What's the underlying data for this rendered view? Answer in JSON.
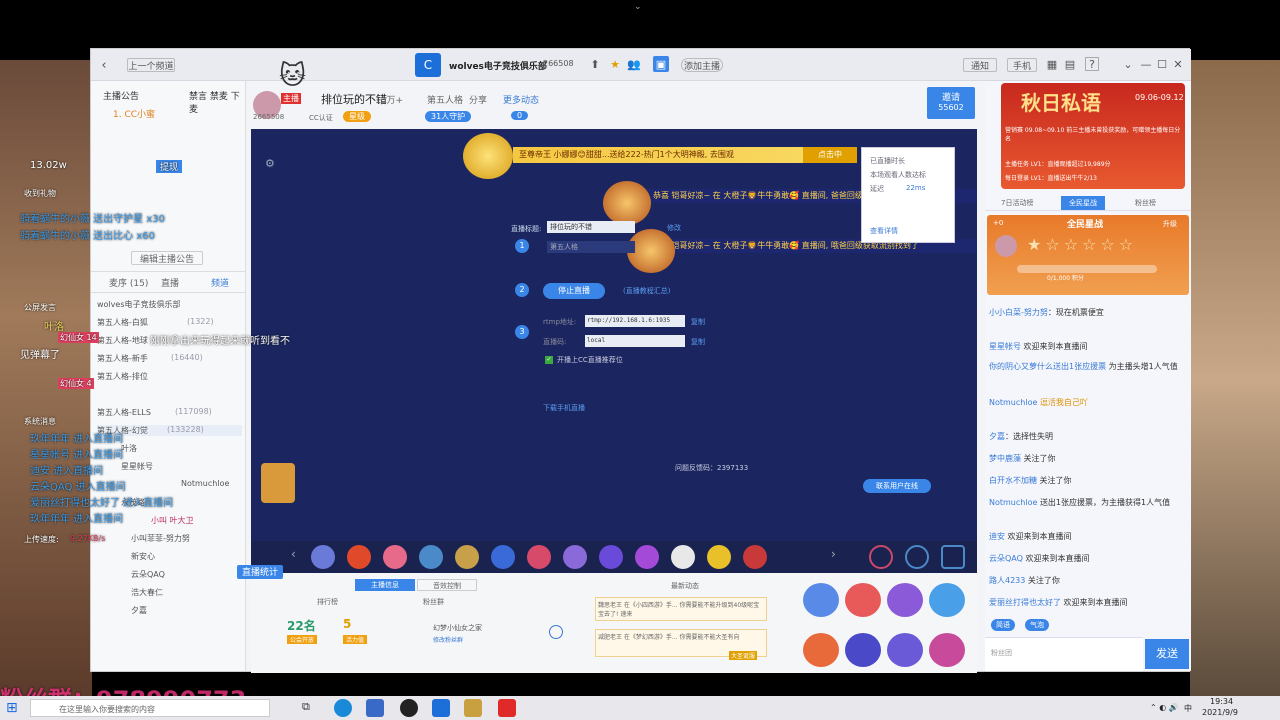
{
  "titlebar": {
    "back_label": "上一个频道",
    "room_name": "wolves电子竞技俱乐部",
    "room_id": "266508",
    "add_anchor": "添加主播",
    "notice": "通知",
    "mobile": "手机"
  },
  "left_panel": {
    "tabs": [
      "主播公告",
      "禁言 禁麦 下麦"
    ],
    "online_item": "1. CC小蜜",
    "announce_btn": "编辑主播公告",
    "subtabs": [
      "麦序\n(15)",
      "直播",
      "频道"
    ],
    "members": [
      "wolves电子竞技俱乐部",
      "第五人格-白狐",
      "第五人格-地球",
      "第五人格-新手",
      "第五人格-排位",
      "第五人格-ELLS",
      "第五人格-幻觉"
    ],
    "member_counts": [
      "",
      "(1322)",
      "",
      "(16440)",
      "",
      "(117098)",
      "(133228)"
    ],
    "users": [
      "叶洛",
      "星星帐号",
      "Notmuchloe",
      "永茂路",
      "小叫 叶大卫",
      "小叫菲菲-努力努",
      "新安心",
      "云朵QAQ",
      "浩大春仁",
      "夕嘉"
    ],
    "stats_btn": "直播统计"
  },
  "overlay": {
    "viewers": "13.02w",
    "withdraw": "提现",
    "gifts_label": "收到礼物",
    "gift1": "骑着蜗牛的小薇 送出守护星 x30",
    "gift2": "骑着蜗牛的小薇 送出比心 x60",
    "public_label": "公屏发言",
    "pub1": "叶洛",
    "pub2": "幻仙女 14",
    "pub3": "幻仙女 4",
    "pub_msg": "刚刚拿出来玩得起来就听到看不",
    "pub_msg2": "见弹幕了",
    "system_label": "系统消息",
    "sys1": "玖年年年 进入直播间",
    "sys2": "星星帐号 进入直播间",
    "sys3": "迪安 进入直播间",
    "sys4": "云朵QAQ 进入直播间",
    "sys5": "爱丽丝打得也太好了 进入直播间",
    "sys6": "玖年年年 进入直播间",
    "upload": "上传速度:",
    "upload_val": "9.27KB/s",
    "watermark": "粉丝群：978990773"
  },
  "anchor": {
    "name": "排位玩的不错",
    "followers": "13万+",
    "tag1": "第五人格",
    "share": "分享",
    "more": "更多动态",
    "id": "2665508",
    "cc_label": "CC认证",
    "star": "星级",
    "protect": "31人守护",
    "zero": "0",
    "invite": "邀请",
    "invite_count": "55602"
  },
  "stream": {
    "banner": "至尊帝王 小娜娜😊甜甜...送给222-热门1个大明神殿, 去围观",
    "banner_btn": "点击中",
    "notif1": "恭喜 铠哥好凉~ 在 大橙子🦁牛牛勇敢🥰 直播间, 爸爸回级获取流别找到了 定",
    "notif2": "恭喜 铠哥好凉~ 在 大橙子🦁牛牛勇敢🥰 直播间, 哦爸回级获取流别找到了",
    "title_label": "直播标题:",
    "title_value": "排位玩的不错",
    "title_edit": "修改",
    "game_value": "第五人格",
    "game_edit": "修改",
    "step1": "1",
    "step2": "2",
    "step3": "3",
    "stop_btn": "停止直播",
    "tools_link": "(直播教程汇总)",
    "rtmp_label": "rtmp地址:",
    "rtmp_value": "rtmp://192.168.1.6:1935",
    "copy1": "复制",
    "key_label": "直播码:",
    "key_value": "local",
    "copy2": "复制",
    "checkbox_label": "开播上CC直播推荐位",
    "download": "下载手机直播",
    "feedback_code": "问题反馈码：2397133",
    "contact_btn": "联系用户在线",
    "popup_title": "已直播时长",
    "popup_line1": "本场观看人数达标",
    "popup_line2": "延迟",
    "popup_latency": "22ms",
    "popup_link": "查看详情"
  },
  "bottom": {
    "tab1": "主播信息",
    "tab2": "音效控制",
    "rank_label": "排行榜",
    "fans_label": "粉丝群",
    "rank_value": "22名",
    "fans_value": "5",
    "rank_sub": "公会开放",
    "fans_sub": "活力值",
    "fanclub": "幻梦小仙女之家",
    "fanclub_sub": "修改粉丝群",
    "news_label": "最新动态",
    "card1": "魏思老王 在《小四西游》手... 你需要能不能升级到40级呢宝宝去了! 速来",
    "card1_link": "点击前往",
    "card2": "减肥老王 在《梦幻西游》手... 你需要能不能大圣有向",
    "card2_link": "点击前往",
    "card2_tag": "大圣诞服",
    "icons": [
      "积分商城",
      "抽奖",
      "大赢家",
      "月光宝盒",
      "骑团大师",
      "守护榜",
      "分享团",
      "百宝箱"
    ]
  },
  "right": {
    "event_title": "秋日私语",
    "event_date": "09.06-09.12",
    "task1": "营销赛 09.08~09.10 前三主播未曾投获奖励，可赠领主播每日分名",
    "task2": "主播任务 LV1：直播观播超过19,989分",
    "task3": "每日登录 LV1：直播送出牛牛2/13",
    "tabs": [
      "7日活动榜",
      "全民星战",
      "粉丝榜"
    ],
    "stars_label": "全民星战",
    "stars_score": "+0",
    "star_btn": "升级",
    "progress": "0/1,000 积分",
    "chat": [
      {
        "badge": "幻仙女",
        "user": "小小白菜-努力努",
        "msg": "现在机票便宜"
      },
      {
        "badge": "新安心",
        "user": "星星帐号",
        "msg": "欢迎来到本直播间"
      },
      {
        "badge": "",
        "user": "你的阴心又萝什么送出1张应援票",
        "msg": "为主播头增1人气值"
      },
      {
        "badge": "幻仙女 14",
        "user": "Notmuchloe",
        "msg": "逗活我自己吖"
      },
      {
        "badge": "",
        "user": "夕嘉",
        "msg": "选择性失明"
      },
      {
        "badge": "",
        "user": "梦中鹿藻",
        "msg": "关注了你"
      },
      {
        "badge": "",
        "user": "白开水不加糖",
        "msg": "关注了你"
      },
      {
        "badge": "",
        "user": "Notmuchloe",
        "msg": "送出1张应援票，为主播获得1人气值"
      },
      {
        "badge": "",
        "user": "迪安",
        "msg": "欢迎来到本直播间"
      },
      {
        "badge": "",
        "user": "云朵QAQ",
        "msg": "欢迎来到本直播间"
      },
      {
        "badge": "",
        "user": "路人4233",
        "msg": "关注了你"
      },
      {
        "badge": "",
        "user": "爱丽丝打得也太好了",
        "msg": "欢迎来到本直播间"
      }
    ],
    "input_placeholder": "粉丝团",
    "send_btn": "发送",
    "quick1": "简语",
    "quick2": "气泡"
  },
  "taskbar": {
    "search_placeholder": "在这里输入你要搜索的内容",
    "time": "19:34",
    "date": "2021/9/9",
    "lang": "中"
  }
}
